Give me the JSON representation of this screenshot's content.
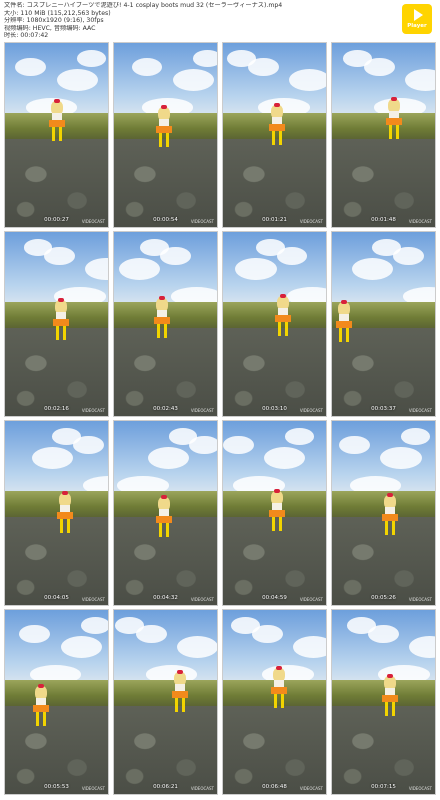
{
  "header": {
    "lines": [
      "文件名: コスプレニーハイブーツで泥遊び! 4-1 cosplay boots mud 32 (セーラーヴィーナス).mp4",
      "大小: 110 MiB (115,212,563 bytes)",
      "分辨率: 1080x1920 (9:16), 30fps",
      "视频编码: HEVC, 音频编码: AAC",
      "时长: 00:07:42"
    ]
  },
  "player": {
    "label": "Player",
    "icon": "play-icon"
  },
  "watermark": "VIDEOCAST",
  "thumbnails": [
    {
      "time": "00:00:27"
    },
    {
      "time": "00:00:54"
    },
    {
      "time": "00:01:21"
    },
    {
      "time": "00:01:48"
    },
    {
      "time": "00:02:16"
    },
    {
      "time": "00:02:43"
    },
    {
      "time": "00:03:10"
    },
    {
      "time": "00:03:37"
    },
    {
      "time": "00:04:05"
    },
    {
      "time": "00:04:32"
    },
    {
      "time": "00:04:59"
    },
    {
      "time": "00:05:26"
    },
    {
      "time": "00:05:53"
    },
    {
      "time": "00:06:21"
    },
    {
      "time": "00:06:48"
    },
    {
      "time": "00:07:15"
    }
  ]
}
